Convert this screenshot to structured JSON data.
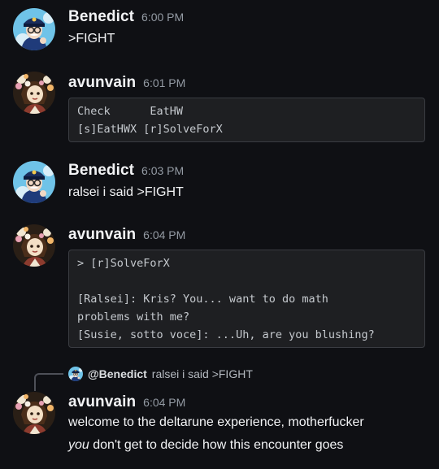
{
  "messages": [
    {
      "username": "Benedict",
      "time": "6:00 PM",
      "text": ">FIGHT",
      "avatar_icon": "police-officer-avatar"
    },
    {
      "username": "avunvain",
      "time": "6:01 PM",
      "code": "Check      EatHW\n[s]EatHWX [r]SolveForX",
      "avatar_icon": "flower-character-avatar"
    },
    {
      "username": "Benedict",
      "time": "6:03 PM",
      "text": "ralsei i said >FIGHT",
      "avatar_icon": "police-officer-avatar"
    },
    {
      "username": "avunvain",
      "time": "6:04 PM",
      "code": "> [r]SolveForX\n\n[Ralsei]: Kris? You... want to do math\nproblems with me?\n[Susie, sotto voce]: ...Uh, are you blushing?",
      "avatar_icon": "flower-character-avatar"
    },
    {
      "reply_to": {
        "mention": "@Benedict",
        "text": "ralsei i said >FIGHT"
      },
      "username": "avunvain",
      "time": "6:04 PM",
      "text_line1": "welcome to the deltarune experience, motherfucker",
      "text_line2_em": "you",
      "text_line2_rest": " don't get to decide how this encounter goes",
      "avatar_icon": "flower-character-avatar"
    }
  ],
  "colors": {
    "background": "#0f1014",
    "username": "#f2f3f5",
    "timestamp": "#949ba4",
    "codeblock_bg": "#1e1f22"
  }
}
